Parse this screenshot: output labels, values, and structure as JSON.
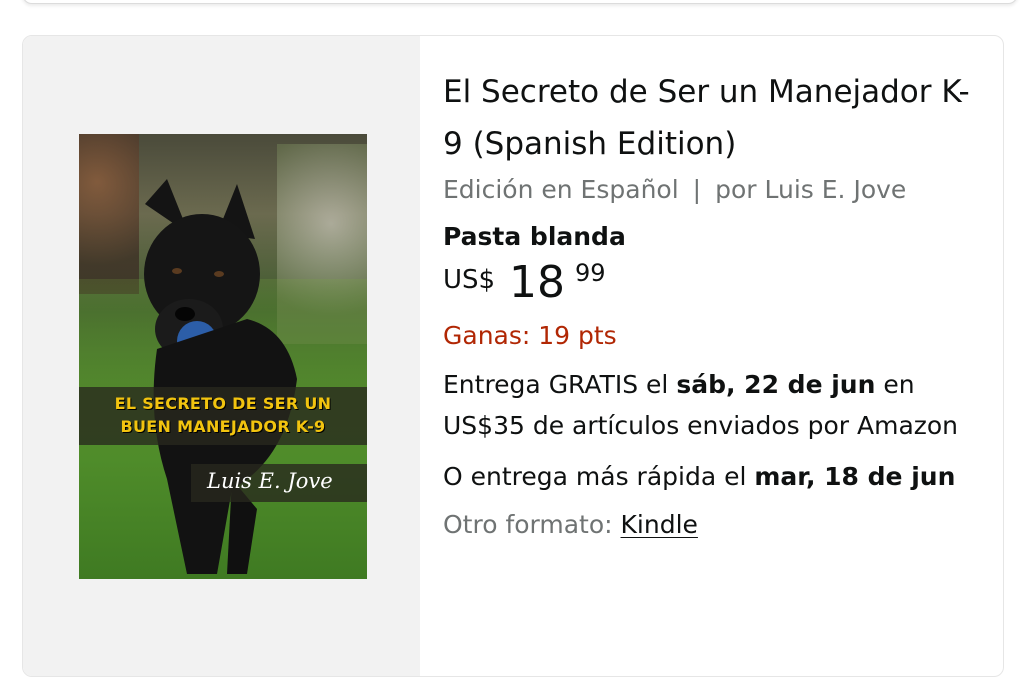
{
  "product": {
    "title": "El Secreto de Ser un Manejador K-9 (Spanish Edition)",
    "edition": "Edición en Español",
    "separator": "|",
    "author": "por Luis E. Jove",
    "format": "Pasta blanda",
    "price": {
      "currency": "US$",
      "whole": "18",
      "fraction": "99"
    },
    "points": "Ganas: 19 pts",
    "delivery": {
      "prefix": "Entrega GRATIS el ",
      "date": "sáb, 22 de jun",
      "suffix": " en US$35 de artículos enviados por Amazon"
    },
    "faster_delivery": {
      "prefix": "O entrega más rápida el ",
      "date": "mar, 18 de jun"
    },
    "other_format": {
      "label": "Otro formato: ",
      "link": "Kindle"
    },
    "cover": {
      "title_line1": "EL SECRETO DE SER UN",
      "title_line2": "BUEN MANEJADOR K-9",
      "author": "Luis E. Jove"
    }
  },
  "colors": {
    "points_red": "#b12704",
    "meta_gray": "#6f7373",
    "cover_title_yellow": "#f2c40f"
  }
}
